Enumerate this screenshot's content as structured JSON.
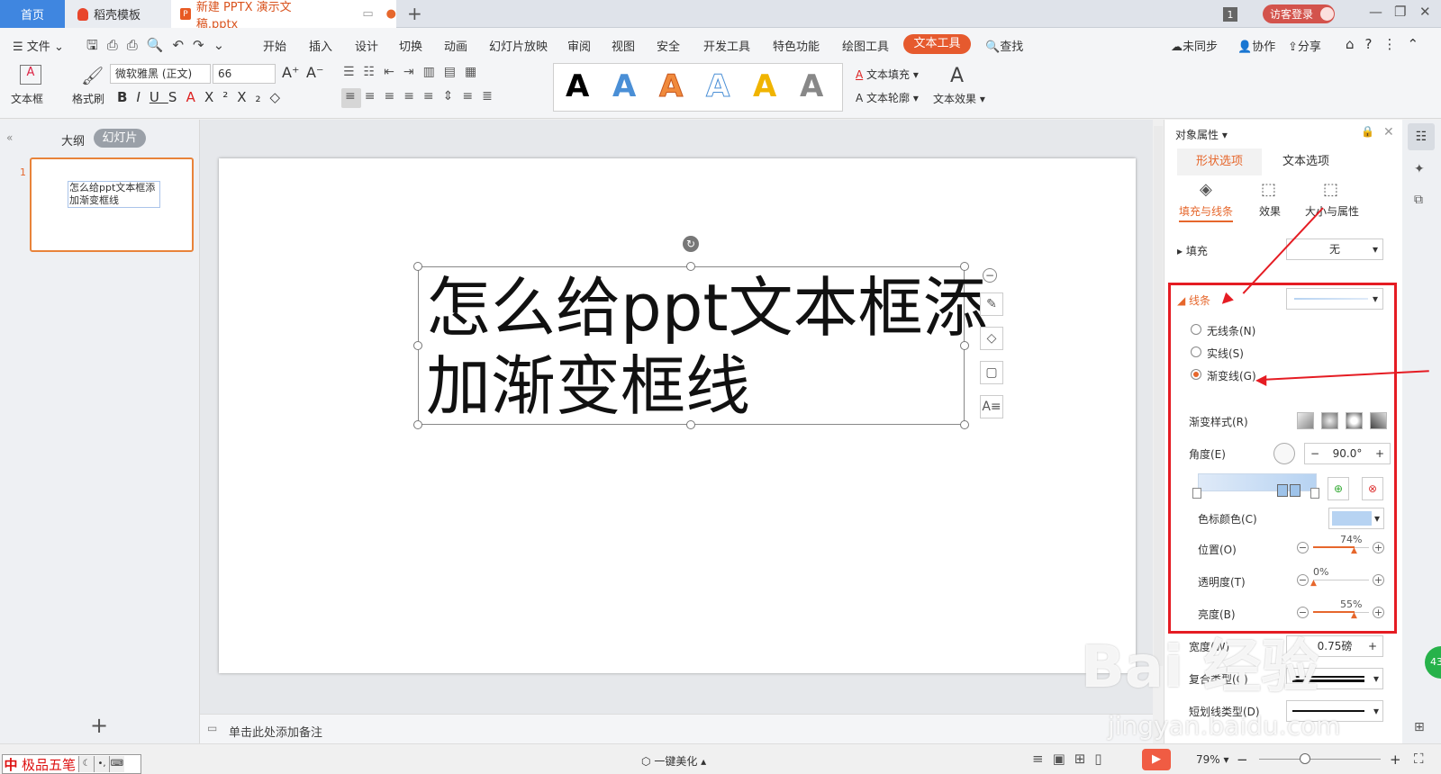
{
  "tabs": {
    "home": "首页",
    "template": "稻壳模板",
    "document": "新建 PPTX 演示文稿.pptx",
    "new_tab": "+"
  },
  "titlebar": {
    "window_count": "1",
    "login": "访客登录"
  },
  "menu": {
    "file": "文件",
    "items": [
      "开始",
      "插入",
      "设计",
      "切换",
      "动画",
      "幻灯片放映",
      "审阅",
      "视图",
      "安全",
      "开发工具",
      "特色功能",
      "绘图工具",
      "文本工具"
    ],
    "search": "查找",
    "sync": "未同步",
    "collab": "协作",
    "share": "分享"
  },
  "ribbon": {
    "textbox": "文本框",
    "format_painter": "格式刷",
    "font_name": "微软雅黑 (正文)",
    "font_size": "66",
    "wordart_letter": "A",
    "text_fill": "文本填充",
    "text_outline": "文本轮廓",
    "text_effect": "文本效果",
    "wordart_colors": [
      "#000000",
      "#4a8fd6",
      "#f08a3c",
      "#ffffff",
      "#f0b400",
      "#888888"
    ]
  },
  "left_panel": {
    "outline_tab": "大纲",
    "slides_tab": "幻灯片",
    "slide_number": "1",
    "thumb_text": "怎么给ppt文本框添加渐变框线",
    "add": "+"
  },
  "slide": {
    "text_line1": "怎么给ppt文本框添",
    "text_line2": "加渐变框线"
  },
  "notes": {
    "placeholder": "单击此处添加备注"
  },
  "right_panel": {
    "title": "对象属性",
    "tab_shape": "形状选项",
    "tab_text": "文本选项",
    "sub_fill_line": "填充与线条",
    "sub_effect": "效果",
    "sub_size": "大小与属性",
    "fill_label": "填充",
    "fill_value": "无",
    "line_label": "线条",
    "radio_none": "无线条(N)",
    "radio_solid": "实线(S)",
    "radio_gradient": "渐变线(G)",
    "gradient_style": "渐变样式(R)",
    "angle_label": "角度(E)",
    "angle_value": "90.0°",
    "stop_color": "色标颜色(C)",
    "position_label": "位置(O)",
    "position_value": "74%",
    "transparency_label": "透明度(T)",
    "transparency_value": "0%",
    "brightness_label": "亮度(B)",
    "brightness_value": "55%",
    "width_label": "宽度(W)",
    "width_value": "0.75磅",
    "compound_label": "复合类型(C)",
    "dash_label": "短划线类型(D)",
    "stop_color_hex": "#b7d3f2"
  },
  "statusbar": {
    "ime_cn": "中",
    "ime_name": "极品五笔",
    "beautify": "一键美化",
    "zoom": "79%"
  },
  "watermark": {
    "text": "Bai 经验",
    "url": "jingyan.baidu.com"
  }
}
